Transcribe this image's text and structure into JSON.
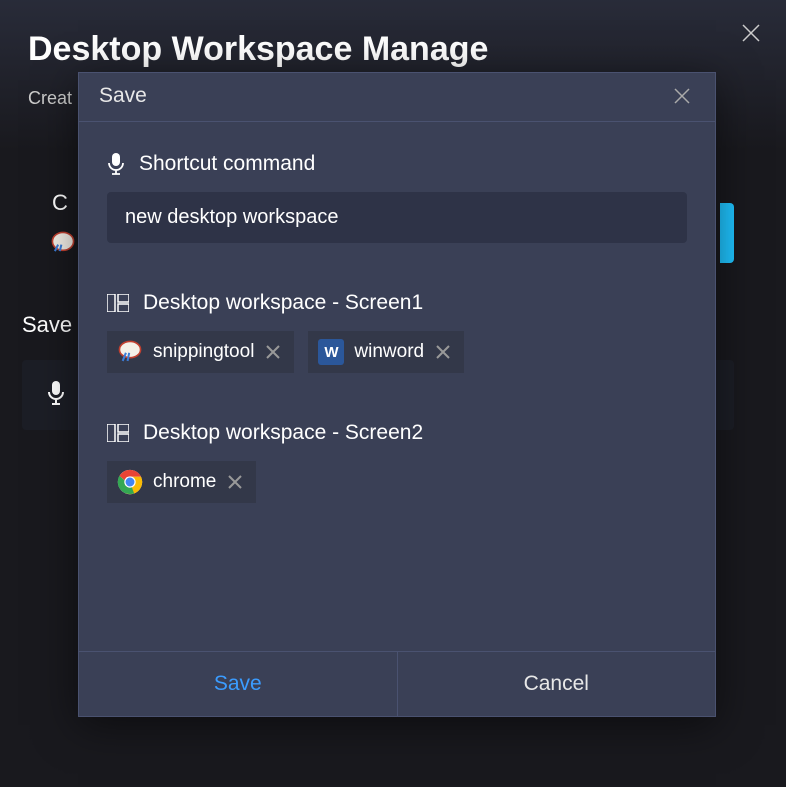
{
  "main": {
    "title": "Desktop Workspace Manage",
    "subtitle": "Creat",
    "section_c": "C",
    "section_save": "Save"
  },
  "modal": {
    "title": "Save",
    "shortcut_label": "Shortcut command",
    "shortcut_value": "new desktop workspace",
    "screens": [
      {
        "label": "Desktop workspace - Screen1",
        "apps": [
          {
            "name": "snippingtool",
            "icon": "snippingtool-icon"
          },
          {
            "name": "winword",
            "icon": "word-icon"
          }
        ]
      },
      {
        "label": "Desktop workspace - Screen2",
        "apps": [
          {
            "name": "chrome",
            "icon": "chrome-icon"
          }
        ]
      }
    ],
    "save_button": "Save",
    "cancel_button": "Cancel"
  }
}
